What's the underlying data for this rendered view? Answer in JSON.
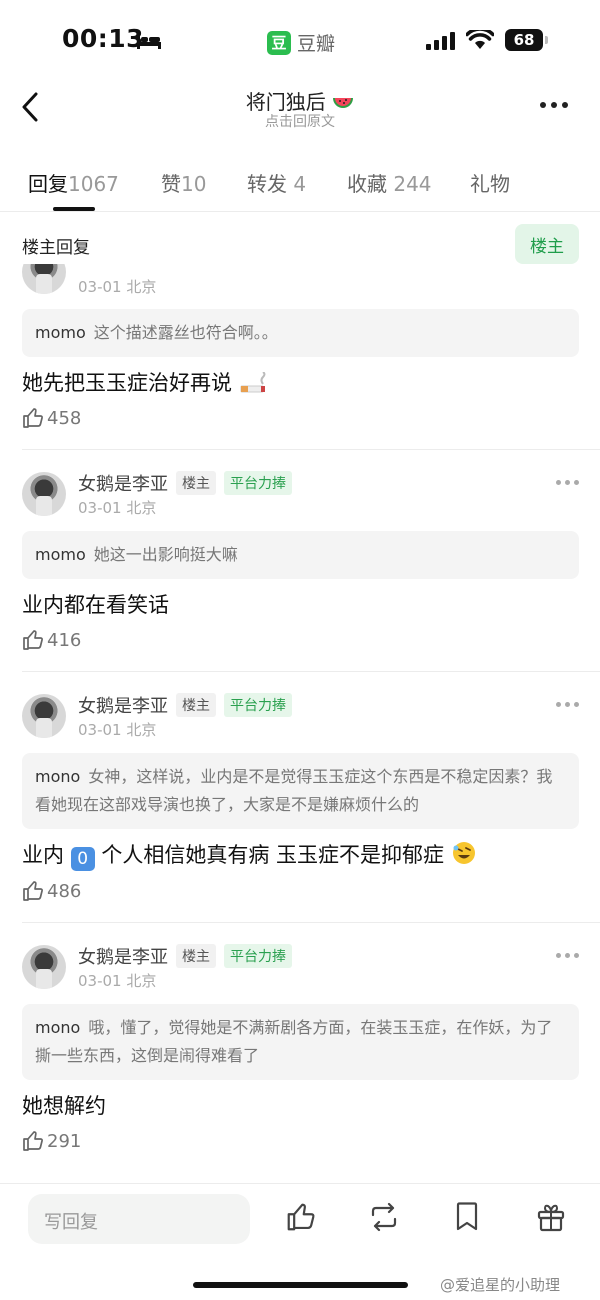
{
  "status_bar": {
    "time": "00:13",
    "app_logo_char": "豆",
    "app_name": "豆瓣",
    "battery": "68"
  },
  "header": {
    "title": "将门独后",
    "subtitle": "点击回原文"
  },
  "tabs": [
    {
      "label": "回复",
      "count": "1067"
    },
    {
      "label": "赞",
      "count": "10"
    },
    {
      "label": "转发",
      "count": "4"
    },
    {
      "label": "收藏",
      "count": "244"
    },
    {
      "label": "礼物",
      "count": ""
    }
  ],
  "owner_bar": {
    "label": "楼主回复",
    "toggle": "楼主"
  },
  "comments": [
    {
      "user": "",
      "badge_owner": "",
      "badge_platform": "",
      "date": "03-01",
      "location": "北京",
      "quote_name": "momo",
      "quote_text": "这个描述露丝也符合啊。。",
      "text": "她先把玉玉症治好再说",
      "likes": "458"
    },
    {
      "user": "女鹅是李亚",
      "badge_owner": "楼主",
      "badge_platform": "平台力捧",
      "date": "03-01",
      "location": "北京",
      "quote_name": "momo",
      "quote_text": "她这一出影响挺大嘛",
      "text": "业内都在看笑话",
      "likes": "416"
    },
    {
      "user": "女鹅是李亚",
      "badge_owner": "楼主",
      "badge_platform": "平台力捧",
      "date": "03-01",
      "location": "北京",
      "quote_name": "mono",
      "quote_text": "女神，这样说，业内是不是觉得玉玉症这个东西是不稳定因素？我看她现在这部戏导演也换了，大家是不是嫌麻烦什么的",
      "text_before": "业内",
      "text_keycap": "0",
      "text_after": "个人相信她真有病 玉玉症不是抑郁症",
      "likes": "486"
    },
    {
      "user": "女鹅是李亚",
      "badge_owner": "楼主",
      "badge_platform": "平台力捧",
      "date": "03-01",
      "location": "北京",
      "quote_name": "mono",
      "quote_text": "哦，懂了，觉得她是不满新剧各方面，在装玉玉症，在作妖，为了撕一些东西，这倒是闹得难看了",
      "text": "她想解约",
      "likes": "291"
    }
  ],
  "bottom_bar": {
    "input_placeholder": "写回复",
    "watermark": "@爱追星的小助理"
  },
  "colors": {
    "brand_green": "#2bbd4f",
    "badge_green": "#2aa04f",
    "owner_toggle_bg": "#e3f5e8"
  },
  "icons": [
    "back-icon",
    "more-icon",
    "thumb-up-icon",
    "repost-icon",
    "bookmark-icon",
    "gift-icon",
    "watermelon-icon",
    "cigarette-icon",
    "rofl-icon",
    "bed-icon",
    "signal-icon",
    "wifi-icon"
  ]
}
